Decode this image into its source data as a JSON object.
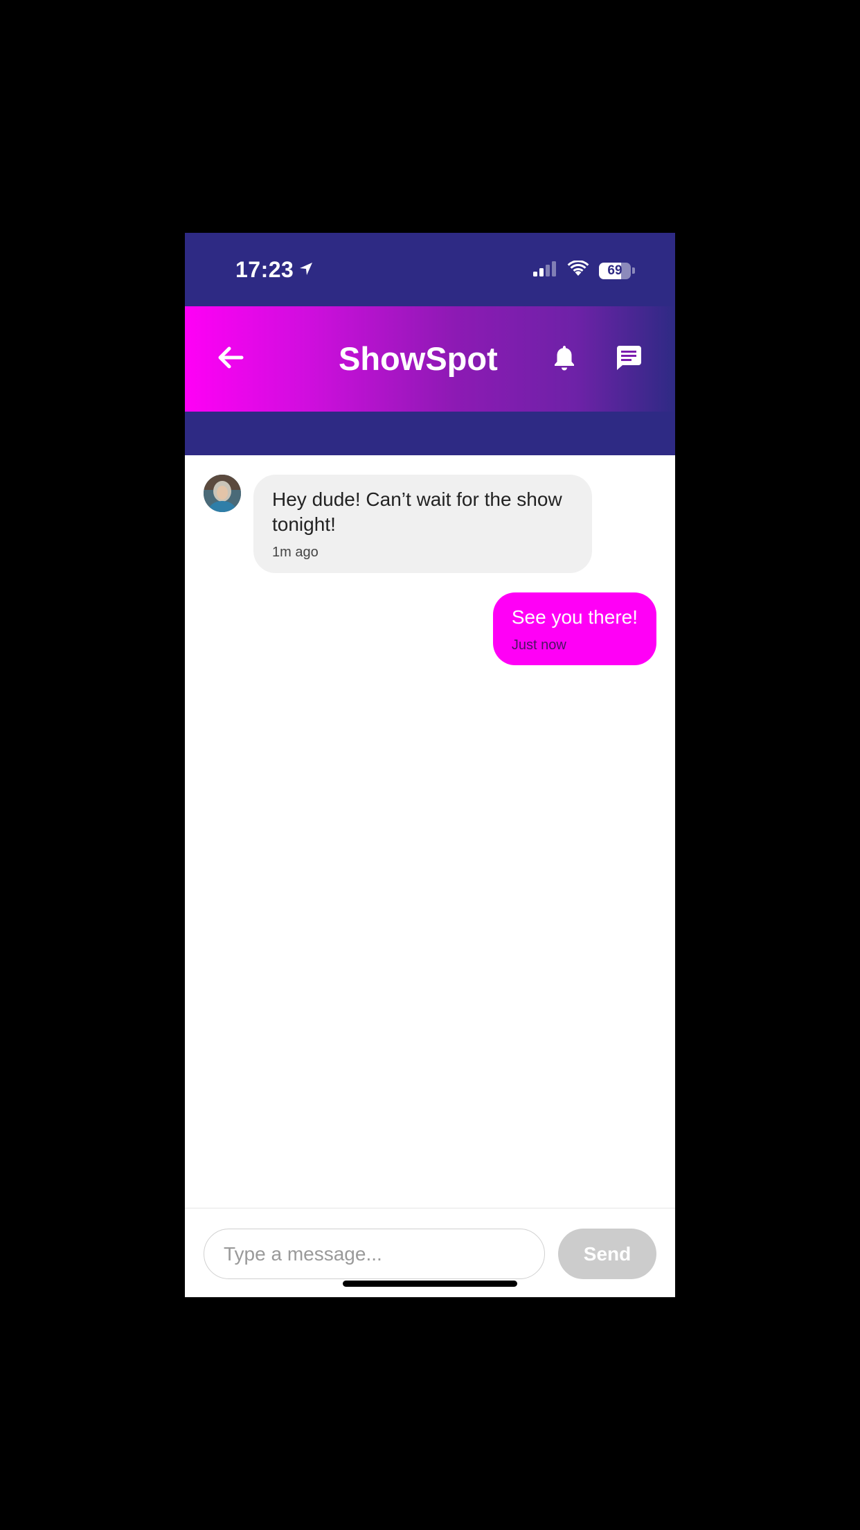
{
  "status_bar": {
    "time": "17:23",
    "battery_level": "69",
    "battery_fraction": 0.69,
    "icons": [
      "location-arrow-icon",
      "signal-icon",
      "wifi-icon",
      "battery-icon"
    ]
  },
  "header": {
    "title": "ShowSpot",
    "back_icon": "arrow-left-icon",
    "notification_icon": "bell-icon",
    "messages_icon": "chat-icon",
    "gradient_colors": [
      "#ff00f6",
      "#8d1ab4",
      "#2e2a84"
    ]
  },
  "conversation": {
    "messages": [
      {
        "direction": "incoming",
        "text": "Hey dude! Can’t wait for the show tonight!",
        "time": "1m ago"
      },
      {
        "direction": "outgoing",
        "text": "See you there!",
        "time": "Just now"
      }
    ]
  },
  "composer": {
    "placeholder": "Type a message...",
    "value": "",
    "send_label": "Send"
  },
  "colors": {
    "brand_dark": "#2e2a84",
    "accent": "#ff00f6",
    "incoming_bubble": "#f0f0f0",
    "send_disabled": "#cccccc"
  }
}
